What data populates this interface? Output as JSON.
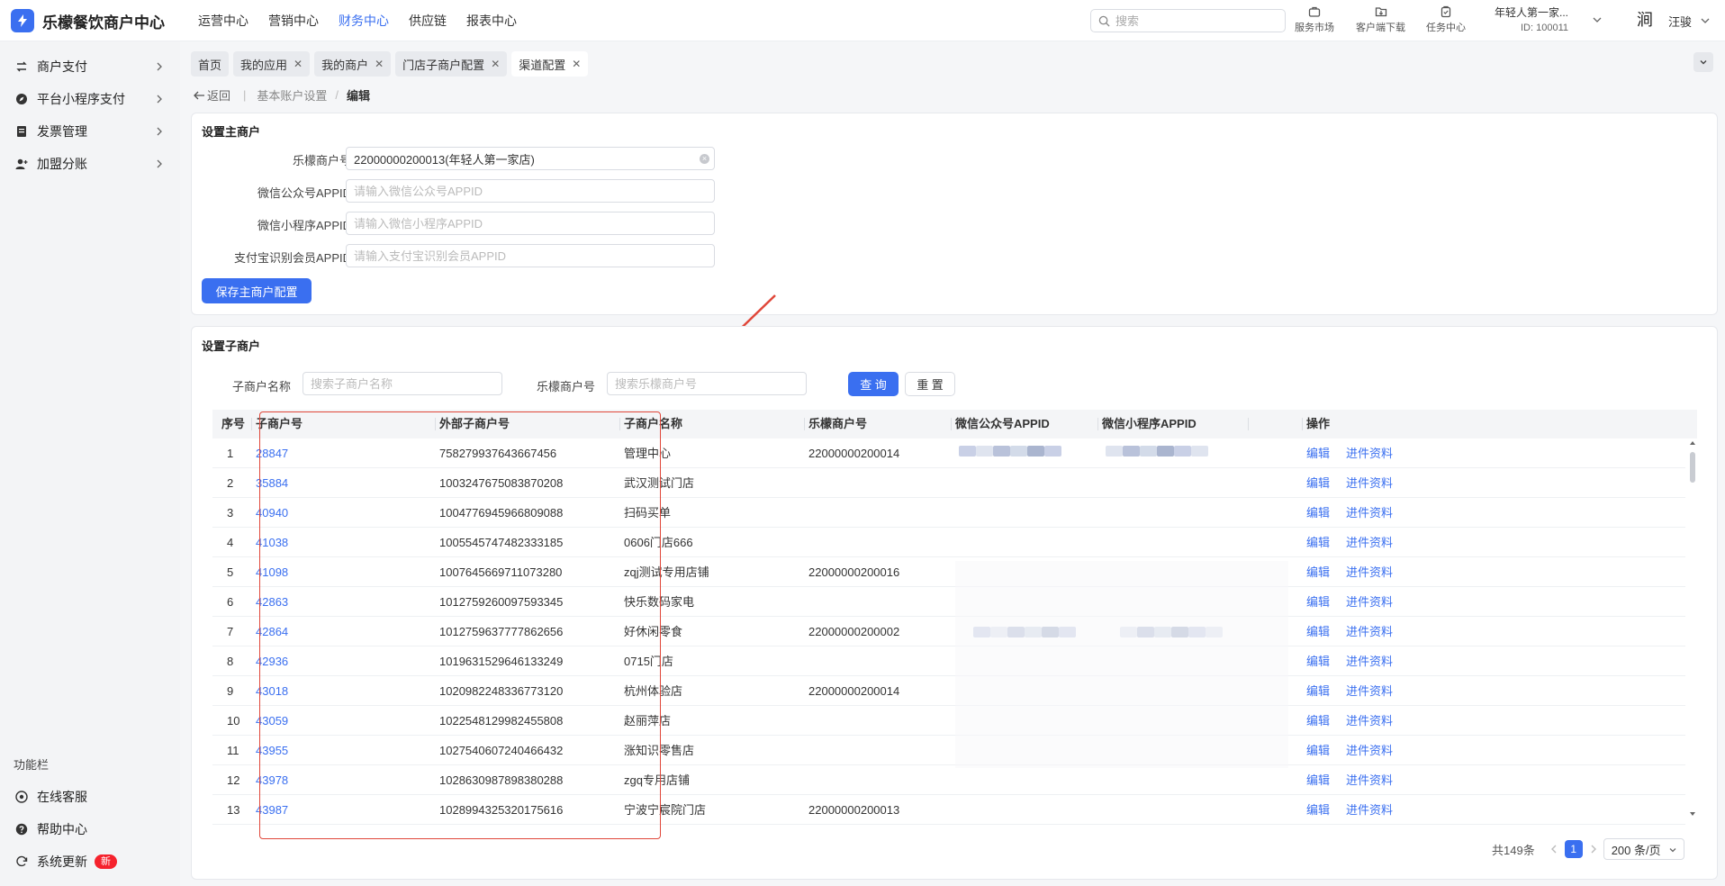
{
  "app": {
    "title": "乐檬餐饮商户中心"
  },
  "topnav": [
    "运营中心",
    "营销中心",
    "财务中心",
    "供应链",
    "报表中心"
  ],
  "topnav_active": 2,
  "search": {
    "placeholder": "搜索"
  },
  "tools": [
    "服务市场",
    "客户端下载",
    "任务中心"
  ],
  "account": {
    "name": "年轻人第一家...",
    "id": "ID: 100011"
  },
  "user": {
    "avatar": "涧",
    "name": "汪骏"
  },
  "sidebar": {
    "items": [
      {
        "label": "商户支付",
        "icon": "exchange-icon"
      },
      {
        "label": "平台小程序支付",
        "icon": "compass-icon"
      },
      {
        "label": "发票管理",
        "icon": "invoice-icon"
      },
      {
        "label": "加盟分账",
        "icon": "user-add-icon"
      }
    ],
    "section_title": "功能栏",
    "bottom": [
      {
        "label": "在线客服",
        "icon": "headset-icon"
      },
      {
        "label": "帮助中心",
        "icon": "help-icon"
      },
      {
        "label": "系统更新",
        "icon": "refresh-icon",
        "badge": "新"
      }
    ]
  },
  "tabs": [
    {
      "label": "首页",
      "closable": false
    },
    {
      "label": "我的应用",
      "closable": true
    },
    {
      "label": "我的商户",
      "closable": true
    },
    {
      "label": "门店子商户配置",
      "closable": true
    },
    {
      "label": "渠道配置",
      "closable": true,
      "active": true
    }
  ],
  "breadcrumb": {
    "back": "返回",
    "parent": "基本账户设置",
    "separator": "/",
    "current": "编辑"
  },
  "main_merchant": {
    "title": "设置主商户",
    "fields": [
      {
        "label": "乐檬商户号",
        "value": "22000000200013(年轻人第一家店)",
        "placeholder": ""
      },
      {
        "label": "微信公众号APPID",
        "value": "",
        "placeholder": "请输入微信公众号APPID"
      },
      {
        "label": "微信小程序APPID",
        "value": "",
        "placeholder": "请输入微信小程序APPID"
      },
      {
        "label": "支付宝识别会员APPID",
        "value": "",
        "placeholder": "请输入支付宝识别会员APPID"
      }
    ],
    "save_label": "保存主商户配置"
  },
  "sub_merchant": {
    "title": "设置子商户",
    "filter_name_label": "子商户名称",
    "filter_name_placeholder": "搜索子商户名称",
    "filter_no_label": "乐檬商户号",
    "filter_no_placeholder": "搜索乐檬商户号",
    "query_label": "查 询",
    "reset_label": "重 置",
    "columns": [
      "序号",
      "子商户号",
      "外部子商户号",
      "子商户名称",
      "乐檬商户号",
      "微信公众号APPID",
      "微信小程序APPID",
      "",
      "操作"
    ],
    "rows": [
      [
        "1",
        "28847",
        "758279937643667456",
        "管理中心",
        "22000000200014"
      ],
      [
        "2",
        "35884",
        "1003247675083870208",
        "武汉测试门店",
        ""
      ],
      [
        "3",
        "40940",
        "1004776945966809088",
        "扫码买单",
        ""
      ],
      [
        "4",
        "41038",
        "1005545747482333185",
        "0606门店666",
        ""
      ],
      [
        "5",
        "41098",
        "1007645669711073280",
        "zqj测试专用店铺",
        "22000000200016"
      ],
      [
        "6",
        "42863",
        "1012759260097593345",
        "快乐数码家电",
        ""
      ],
      [
        "7",
        "42864",
        "1012759637777862656",
        "好休闲零食",
        "22000000200002"
      ],
      [
        "8",
        "42936",
        "1019631529646133249",
        "0715门店",
        ""
      ],
      [
        "9",
        "43018",
        "1020982248336773120",
        "杭州体验店",
        "22000000200014"
      ],
      [
        "10",
        "43059",
        "1022548129982455808",
        "赵丽萍店",
        ""
      ],
      [
        "11",
        "43955",
        "1027540607240466432",
        "涨知识零售店",
        ""
      ],
      [
        "12",
        "43978",
        "1028630987898380288",
        "zgq专用店铺",
        ""
      ],
      [
        "13",
        "43987",
        "1028994325320175616",
        "宁波宁宸院门店",
        "22000000200013"
      ]
    ],
    "edit_label": "编辑",
    "info_label": "进件资料"
  },
  "pagination": {
    "total": "共149条",
    "current_page": "1",
    "page_size": "200 条/页"
  },
  "colors": {
    "primary": "#3a6ff0",
    "annotation": "#e0473a",
    "badge": "#f5222d"
  }
}
